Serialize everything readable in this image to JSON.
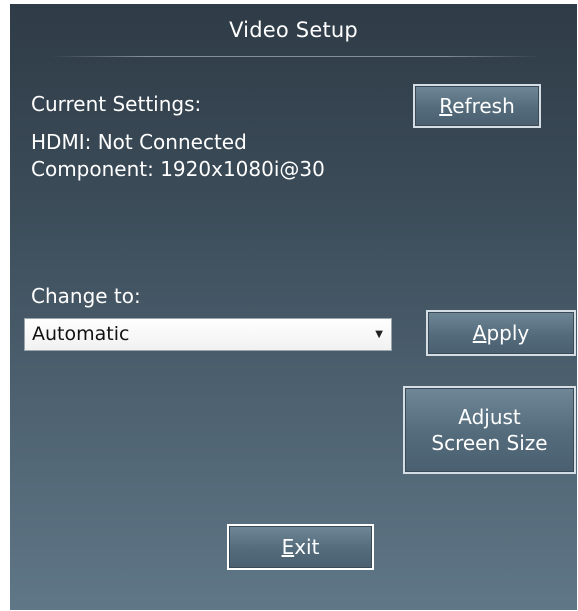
{
  "window": {
    "title": "Video Setup"
  },
  "current": {
    "heading": "Current Settings:",
    "hdmi": "HDMI: Not Connected",
    "component": "Component: 1920x1080i@30"
  },
  "change": {
    "label": "Change to:",
    "selected": "Automatic"
  },
  "buttons": {
    "refresh": {
      "mnemonic": "R",
      "rest": "efresh"
    },
    "apply": {
      "mnemonic": "A",
      "rest": "pply"
    },
    "adjust_line1": "Adjust",
    "adjust_line2": "Screen Size",
    "exit": {
      "mnemonic": "E",
      "rest": "xit"
    }
  },
  "icons": {
    "dropdown": "chevron-down-icon"
  }
}
